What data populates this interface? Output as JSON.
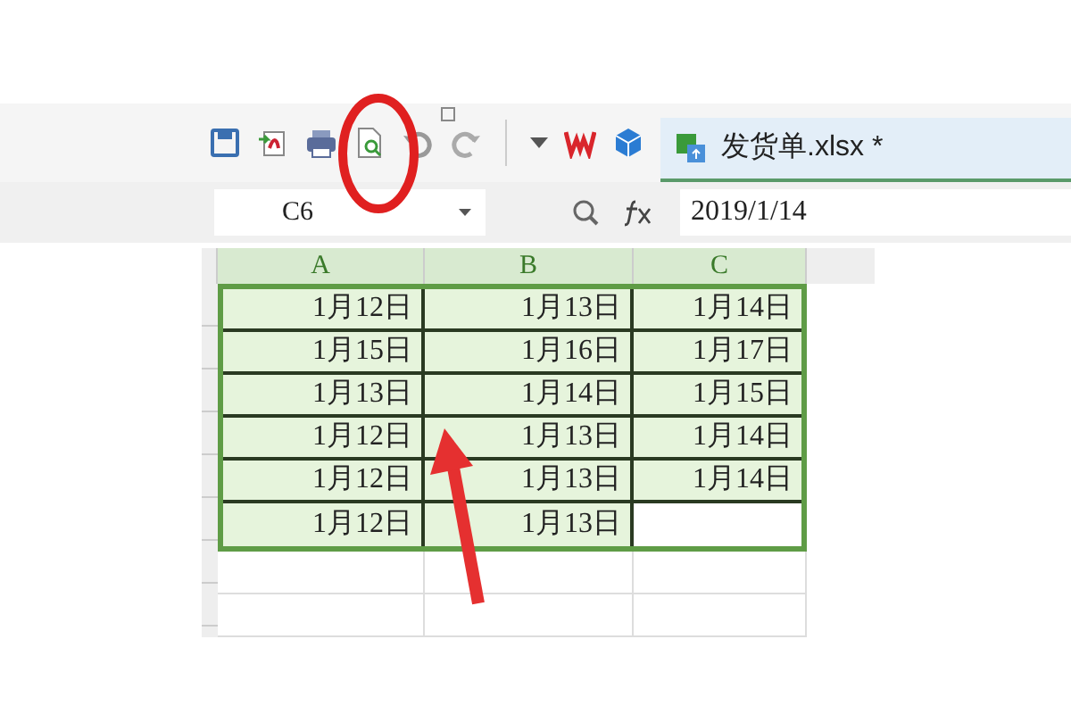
{
  "tab": {
    "label": "发货单.xlsx *",
    "selected": true
  },
  "name_box": {
    "value": "C6"
  },
  "formula_bar": {
    "value": "2019/1/14"
  },
  "columns": [
    {
      "label": "A",
      "selected": true
    },
    {
      "label": "B",
      "selected": true
    },
    {
      "label": "C",
      "selected": true
    }
  ],
  "rows": [
    [
      "1月12日",
      "1月13日",
      "1月14日"
    ],
    [
      "1月15日",
      "1月16日",
      "1月17日"
    ],
    [
      "1月13日",
      "1月14日",
      "1月15日"
    ],
    [
      "1月12日",
      "1月13日",
      "1月14日"
    ],
    [
      "1月12日",
      "1月13日",
      "1月14日"
    ],
    [
      "1月12日",
      "1月13日"
    ]
  ]
}
